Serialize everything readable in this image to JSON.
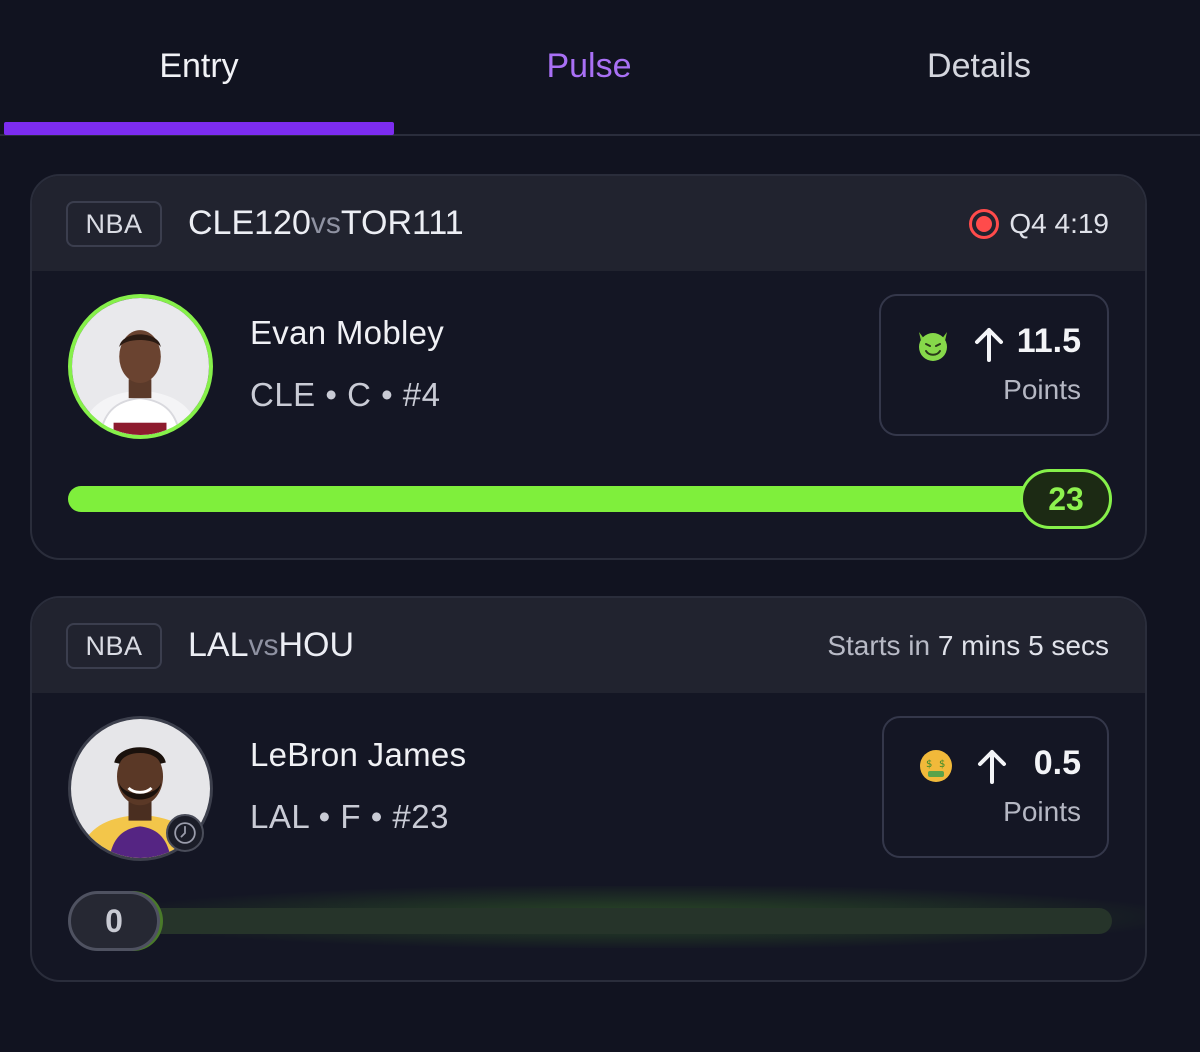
{
  "tabs": [
    {
      "label": "Entry",
      "active": true
    },
    {
      "label": "Pulse",
      "active": false
    },
    {
      "label": "Details",
      "active": false
    }
  ],
  "colors": {
    "accent_purple": "#7c2cf0",
    "pulse_text": "#a970f5",
    "progress_green": "#7fef3c",
    "live_red": "#ff4b4b",
    "background": "#111320"
  },
  "games": [
    {
      "league": "NBA",
      "home_team": "CLE",
      "home_score": "120",
      "vs": "vs",
      "away_team": "TOR",
      "away_score": "111",
      "status_icon": "live-record-icon",
      "status_text": "Q4 4:19",
      "player": {
        "name": "Evan Mobley",
        "meta": "CLE • C • #4",
        "avatar": "player-headshot"
      },
      "pick": {
        "emoji": "devil-emoji-icon",
        "direction_icon": "arrow-up-icon",
        "line": "11.5",
        "stat": "Points"
      },
      "current_value": "23",
      "progress_fraction": 1.0
    },
    {
      "league": "NBA",
      "home_team": "LAL",
      "vs": "vs",
      "away_team": "HOU",
      "status_prefix": "Starts in ",
      "status_time": "7 mins 5 secs",
      "player": {
        "name": "LeBron James",
        "meta": "LAL • F • #23",
        "avatar": "player-headshot",
        "badge_icon": "clock-icon"
      },
      "pick": {
        "emoji": "money-mouth-emoji-icon",
        "direction_icon": "arrow-up-icon",
        "line": "0.5",
        "stat": "Points"
      },
      "current_value": "0",
      "progress_fraction": 0.0
    }
  ]
}
